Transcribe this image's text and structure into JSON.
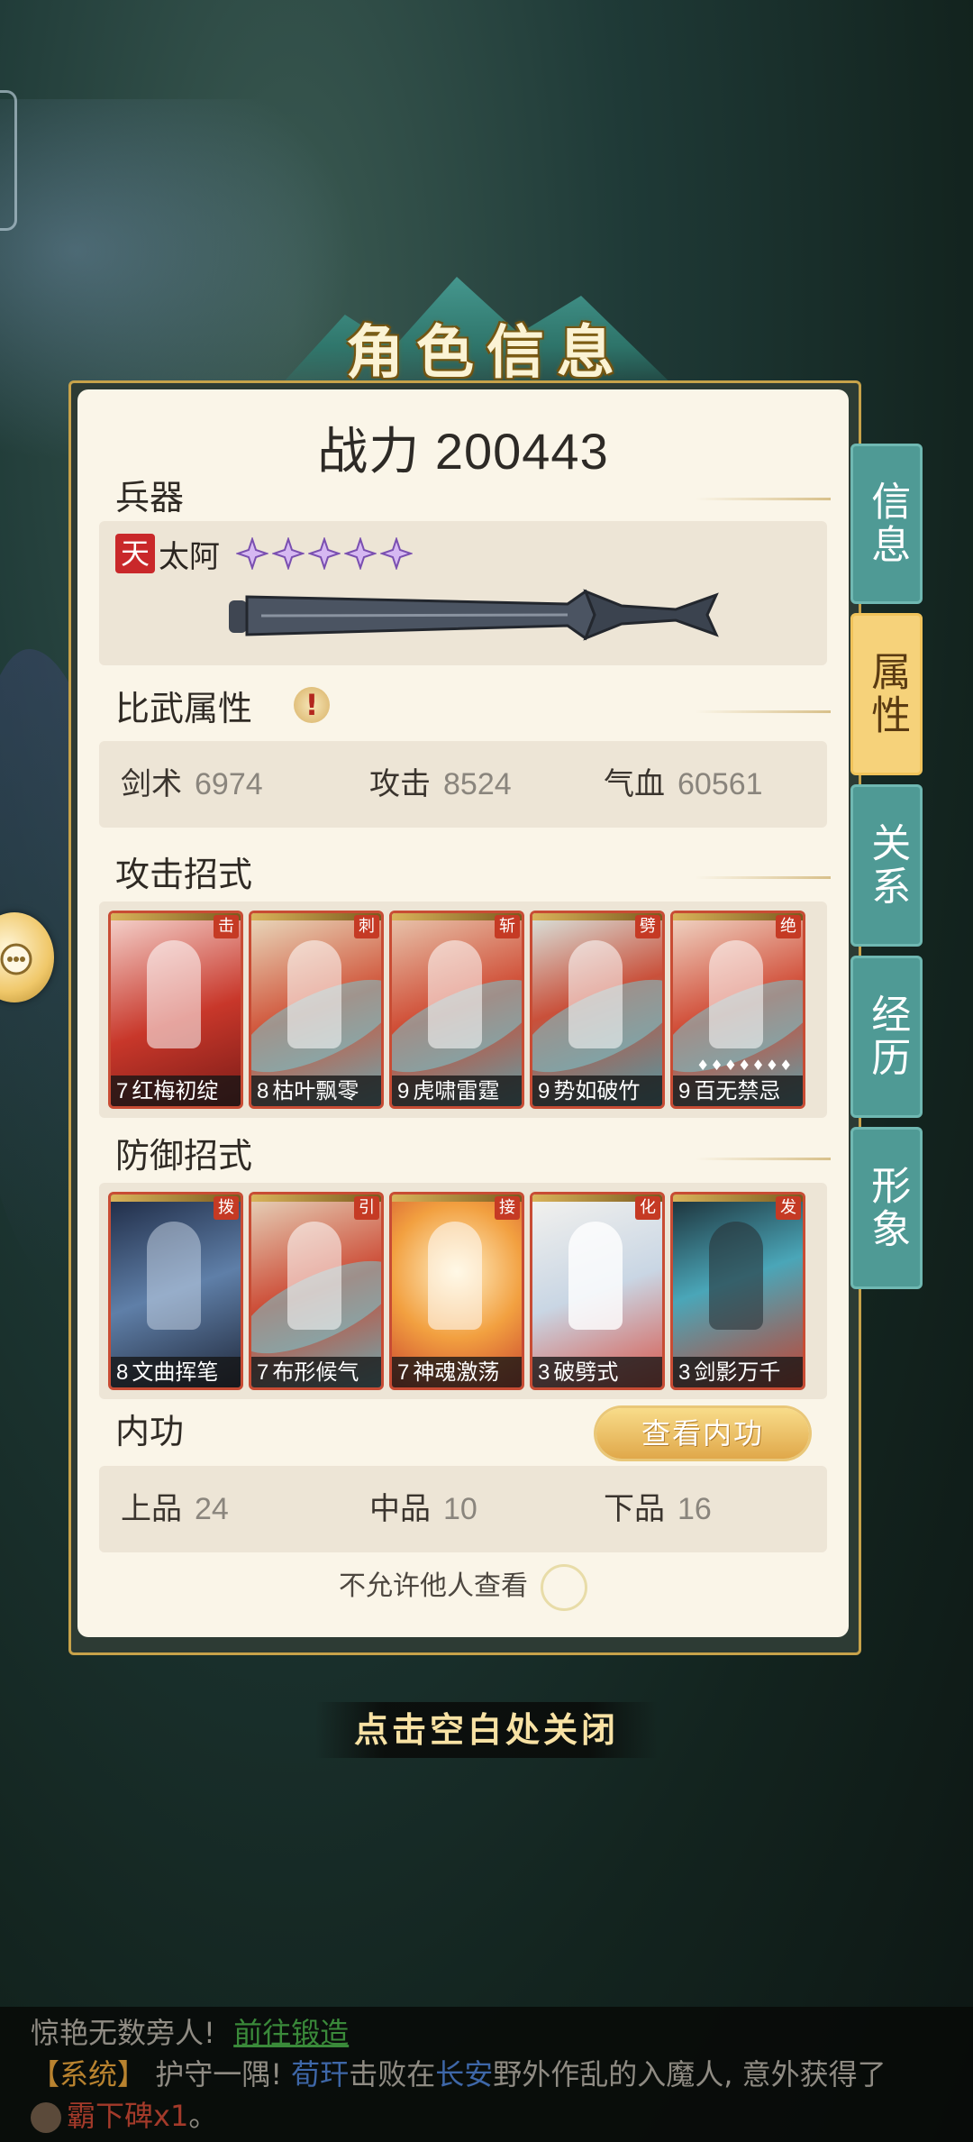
{
  "title": "角色信息",
  "power": {
    "label": "战力",
    "value": "200443"
  },
  "weapon": {
    "section_label": "兵器",
    "grade_badge": "天",
    "name": "太阿",
    "stars": 5
  },
  "combat_attrs": {
    "section_label": "比武属性",
    "warn_icon": "!",
    "stats": [
      {
        "label": "剑术",
        "value": "6974"
      },
      {
        "label": "攻击",
        "value": "8524"
      },
      {
        "label": "气血",
        "value": "60561"
      }
    ]
  },
  "attack_moves": {
    "section_label": "攻击招式",
    "cards": [
      {
        "type": "击",
        "level": "7",
        "name": "红梅初绽"
      },
      {
        "type": "刺",
        "level": "8",
        "name": "枯叶飘零"
      },
      {
        "type": "斩",
        "level": "9",
        "name": "虎啸雷霆"
      },
      {
        "type": "劈",
        "level": "9",
        "name": "势如破竹"
      },
      {
        "type": "绝",
        "level": "9",
        "name": "百无禁忌",
        "diamonds": "♦♦♦♦♦♦♦"
      }
    ]
  },
  "defense_moves": {
    "section_label": "防御招式",
    "cards": [
      {
        "type": "拨",
        "level": "8",
        "name": "文曲挥笔"
      },
      {
        "type": "引",
        "level": "7",
        "name": "布形候气"
      },
      {
        "type": "接",
        "level": "7",
        "name": "神魂激荡"
      },
      {
        "type": "化",
        "level": "3",
        "name": "破劈式"
      },
      {
        "type": "发",
        "level": "3",
        "name": "剑影万千"
      }
    ]
  },
  "neigong": {
    "section_label": "内功",
    "view_button": "查看内功",
    "stats": [
      {
        "label": "上品",
        "value": "24"
      },
      {
        "label": "中品",
        "value": "10"
      },
      {
        "label": "下品",
        "value": "16"
      }
    ]
  },
  "privacy": {
    "label": "不允许他人查看",
    "enabled": false
  },
  "side_tabs": [
    {
      "label": "信息",
      "active": false
    },
    {
      "label": "属性",
      "active": true
    },
    {
      "label": "关系",
      "active": false
    },
    {
      "label": "经历",
      "active": false
    },
    {
      "label": "形象",
      "active": false
    }
  ],
  "close_hint": "点击空白处关闭",
  "chat": {
    "line1_text": "惊艳无数旁人!",
    "line1_link": "前往锻造",
    "line2_tag": "【系统】",
    "line2_a": "护守一隅!",
    "line2_player": "荀玕",
    "line2_b": "击败在",
    "line2_place": "长安",
    "line2_c": "野外作乱的入魔人, 意外获得了",
    "line3_item": "霸下碑",
    "line3_qty": "x1",
    "line3_end": "。"
  }
}
